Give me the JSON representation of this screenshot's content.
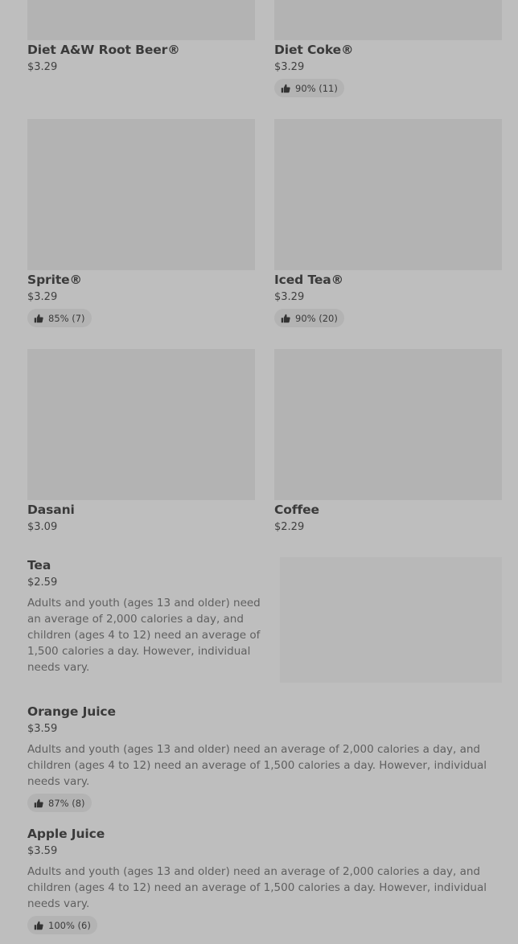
{
  "items": [
    {
      "name": "Diet A&W Root Beer®",
      "price": "$3.29"
    },
    {
      "name": "Diet Coke®",
      "price": "$3.29",
      "rating": "90% (11)"
    },
    {
      "name": "Sprite®",
      "price": "$3.29",
      "rating": "85% (7)"
    },
    {
      "name": "Iced Tea®",
      "price": "$3.29",
      "rating": "90% (20)"
    },
    {
      "name": "Dasani",
      "price": "$3.09"
    },
    {
      "name": "Coffee",
      "price": "$2.29"
    },
    {
      "name": "Tea",
      "price": "$2.59",
      "description": "Adults and youth (ages 13 and older) need an average of 2,000 calories a day, and children (ages 4 to 12) need an average of 1,500 calories a day. However, individual needs vary."
    },
    {
      "name": "Orange Juice",
      "price": "$3.59",
      "description": "Adults and youth (ages 13 and older) need an average of 2,000 calories a day, and children (ages 4 to 12) need an average of 1,500 calories a day. However, individual needs vary.",
      "rating": "87% (8)"
    },
    {
      "name": "Apple Juice",
      "price": "$3.59",
      "description": "Adults and youth (ages 13 and older) need an average of 2,000 calories a day, and children (ages 4 to 12) need an average of 1,500 calories a day. However, individual needs vary.",
      "rating": "100% (6)"
    }
  ],
  "icons": {
    "rating": "thumbs-up-icon"
  }
}
